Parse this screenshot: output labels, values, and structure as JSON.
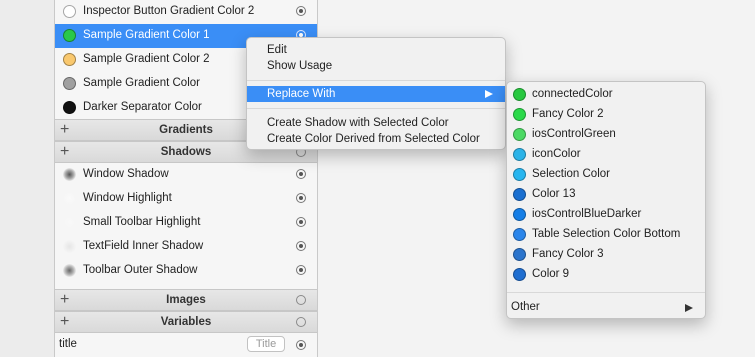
{
  "colors_list": [
    {
      "label": "Inspector Button Gradient Color 2",
      "color": "#ffffff",
      "selected": false
    },
    {
      "label": "Sample Gradient Color 1",
      "color": "#29c84a",
      "selected": true
    },
    {
      "label": "Sample Gradient Color 2",
      "color": "#f9c86e",
      "selected": false
    },
    {
      "label": "Sample Gradient Color",
      "color": "#a0a0a0",
      "selected": false
    },
    {
      "label": "Darker Separator Color",
      "color": "#111111",
      "selected": false
    }
  ],
  "sections": {
    "gradients": "Gradients",
    "shadows": "Shadows",
    "images": "Images",
    "variables": "Variables"
  },
  "shadows_list": [
    {
      "label": "Window Shadow"
    },
    {
      "label": "Window Highlight"
    },
    {
      "label": "Small Toolbar Highlight"
    },
    {
      "label": "TextField Inner Shadow"
    },
    {
      "label": "Toolbar Outer Shadow"
    }
  ],
  "variable_row": {
    "label": "title",
    "value": "Title"
  },
  "context_menu": {
    "edit": "Edit",
    "show_usage": "Show Usage",
    "replace_with": "Replace With",
    "create_shadow": "Create Shadow with Selected Color",
    "create_derived": "Create Color Derived from Selected Color"
  },
  "submenu": {
    "items": [
      {
        "label": "connectedColor",
        "color": "#28c840"
      },
      {
        "label": "Fancy Color 2",
        "color": "#2bd94a"
      },
      {
        "label": "iosControlGreen",
        "color": "#4cd964"
      },
      {
        "label": "iconColor",
        "color": "#2bb3e8"
      },
      {
        "label": "Selection Color",
        "color": "#27b5ef"
      },
      {
        "label": "Color 13",
        "color": "#1a6fd0"
      },
      {
        "label": "iosControlBlueDarker",
        "color": "#157ee6"
      },
      {
        "label": "Table Selection Color Bottom",
        "color": "#2a85ea"
      },
      {
        "label": "Fancy Color 3",
        "color": "#2b74cc"
      },
      {
        "label": "Color 9",
        "color": "#1f6ed0"
      }
    ],
    "other": "Other"
  }
}
